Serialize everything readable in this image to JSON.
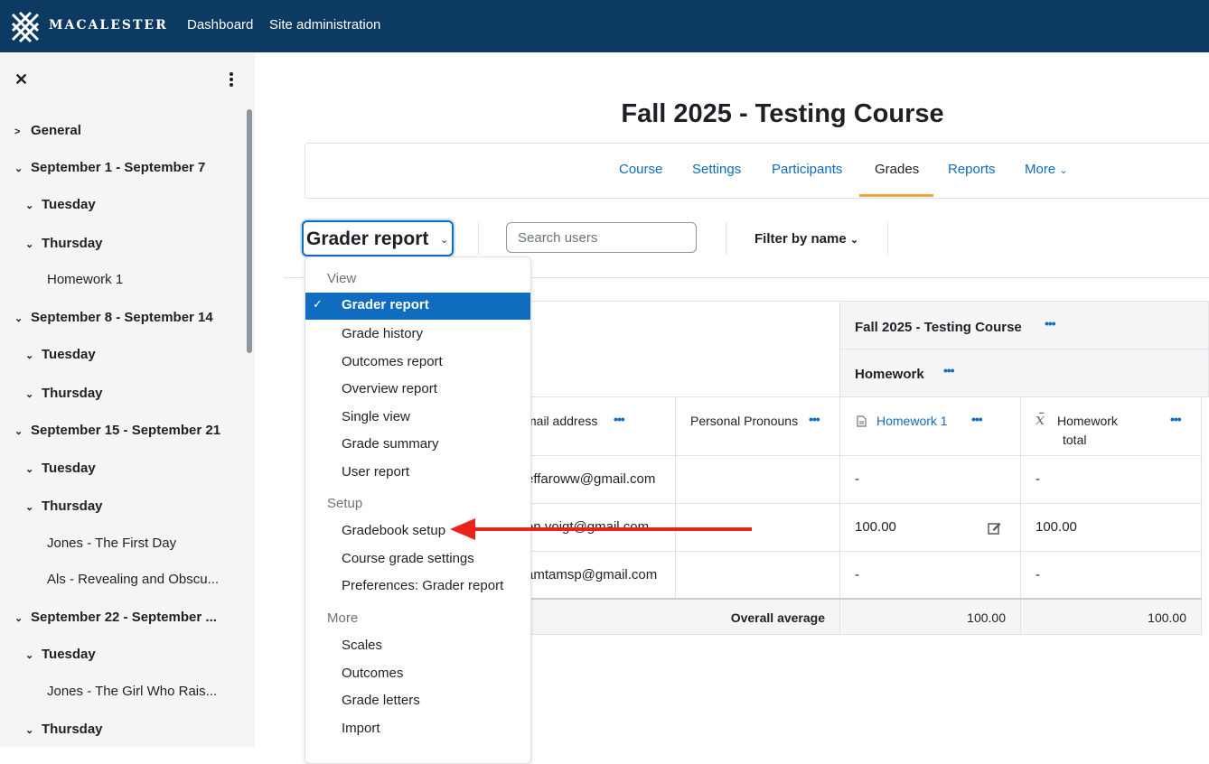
{
  "navbar": {
    "brand": "MACALESTER",
    "links": [
      "Dashboard",
      "Site administration"
    ]
  },
  "drawer": {
    "close_glyph": "✕",
    "items": [
      {
        "label": "General",
        "level": 0,
        "icon": "chevron-right-icon"
      },
      {
        "label": "September 1 - September 7",
        "level": 0,
        "icon": "chevron-down-icon"
      },
      {
        "label": "Tuesday",
        "level": 1,
        "icon": "chevron-down-icon"
      },
      {
        "label": "Thursday",
        "level": 1,
        "icon": "chevron-down-icon"
      },
      {
        "label": "Homework 1",
        "level": 2
      },
      {
        "label": "September 8 - September 14",
        "level": 0,
        "icon": "chevron-down-icon"
      },
      {
        "label": "Tuesday",
        "level": 1,
        "icon": "chevron-down-icon"
      },
      {
        "label": "Thursday",
        "level": 1,
        "icon": "chevron-down-icon"
      },
      {
        "label": "September 15 - September 21",
        "level": 0,
        "icon": "chevron-down-icon"
      },
      {
        "label": "Tuesday",
        "level": 1,
        "icon": "chevron-down-icon"
      },
      {
        "label": "Thursday",
        "level": 1,
        "icon": "chevron-down-icon"
      },
      {
        "label": "Jones - The First Day",
        "level": 2
      },
      {
        "label": "Als - Revealing and Obscu...",
        "level": 2
      },
      {
        "label": "September 22 - September ...",
        "level": 0,
        "icon": "chevron-down-icon"
      },
      {
        "label": "Tuesday",
        "level": 1,
        "icon": "chevron-down-icon"
      },
      {
        "label": "Jones - The Girl Who Rais...",
        "level": 2
      },
      {
        "label": "Thursday",
        "level": 1,
        "icon": "chevron-down-icon"
      }
    ]
  },
  "page": {
    "title": "Fall 2025 - Testing Course"
  },
  "tabs": [
    {
      "label": "Course",
      "active": false
    },
    {
      "label": "Settings",
      "active": false
    },
    {
      "label": "Participants",
      "active": false
    },
    {
      "label": "Grades",
      "active": true
    },
    {
      "label": "Reports",
      "active": false
    },
    {
      "label": "More",
      "active": false
    }
  ],
  "toolbar": {
    "report_selector": "Grader report",
    "search_placeholder": "Search users",
    "filter_label": "Filter by name"
  },
  "menu": {
    "sections": [
      {
        "header": "View",
        "items": [
          "Grader report",
          "Grade history",
          "Outcomes report",
          "Overview report",
          "Single view",
          "Grade summary",
          "User report"
        ]
      },
      {
        "header": "Setup",
        "items": [
          "Gradebook setup",
          "Course grade settings",
          "Preferences: Grader report"
        ]
      },
      {
        "header": "More",
        "items": [
          "Scales",
          "Outcomes",
          "Grade letters",
          "Import"
        ]
      }
    ],
    "selected": "Grader report"
  },
  "grade_table": {
    "course_category": "Fall 2025 - Testing Course",
    "category": "Homework",
    "columns": [
      "mail address",
      "Personal Pronouns",
      "Homework 1",
      "Homework",
      "total"
    ],
    "rows": [
      {
        "email": "effaroww@gmail.com",
        "pronouns": "",
        "homework1": "-",
        "total": "-"
      },
      {
        "email": "en.voigt@gmail.com",
        "pronouns": "",
        "homework1": "100.00",
        "total": "100.00"
      },
      {
        "email": "amtamsp@gmail.com",
        "pronouns": "",
        "homework1": "-",
        "total": "-"
      }
    ],
    "average_label": "Overall average",
    "average_homework1": "100.00",
    "average_total": "100.00"
  },
  "colors": {
    "navbar": "#0c3a63",
    "link": "#0f6cbf",
    "active_tab_underline": "#f0a43a",
    "arrow": "#e8231c"
  }
}
